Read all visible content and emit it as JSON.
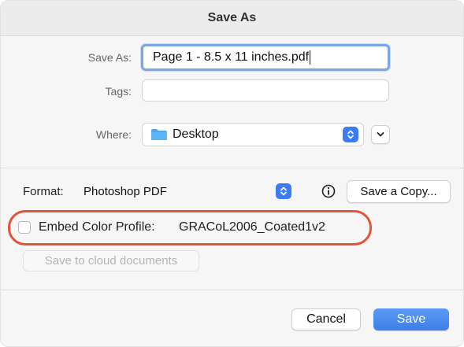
{
  "dialog": {
    "title": "Save As"
  },
  "save_as": {
    "label": "Save As:",
    "value": "Page 1 - 8.5 x 11 inches.pdf"
  },
  "tags": {
    "label": "Tags:",
    "value": ""
  },
  "where": {
    "label": "Where:",
    "selected": "Desktop",
    "icon": "folder-icon"
  },
  "format": {
    "label": "Format:",
    "selected": "Photoshop PDF",
    "info_icon": "info-icon",
    "save_copy_label": "Save a Copy..."
  },
  "embed_color_profile": {
    "label": "Embed Color Profile:",
    "profile": "GRACoL2006_Coated1v2",
    "checked": false
  },
  "cloud": {
    "label": "Save to cloud documents"
  },
  "actions": {
    "cancel_label": "Cancel",
    "save_label": "Save"
  },
  "colors": {
    "accent": "#3e7fe8",
    "highlight": "#e0553a",
    "focus_ring": "#7ba6e8",
    "folder": "#4fa8ee"
  }
}
